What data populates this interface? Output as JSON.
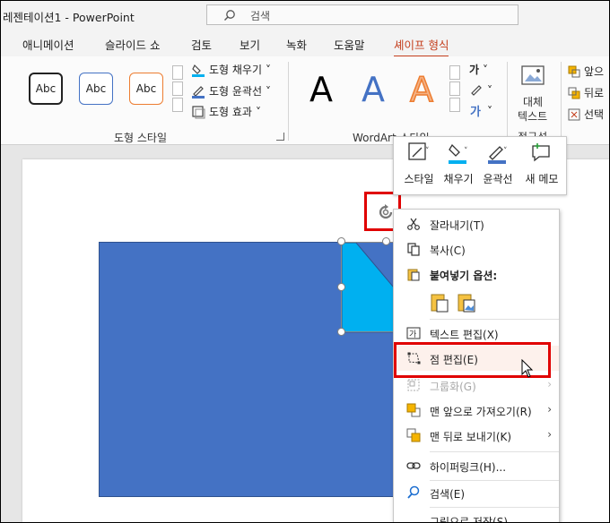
{
  "titlebar": {
    "title": "레젠테이션1  -  PowerPoint",
    "search_placeholder": "검색"
  },
  "tabs": [
    "애니메이션",
    "슬라이드 쇼",
    "검토",
    "보기",
    "녹화",
    "도움말",
    "셰이프 형식"
  ],
  "ribbon": {
    "shape_styles": {
      "swatch_labels": [
        "Abc",
        "Abc",
        "Abc"
      ],
      "fill": "도형 채우기",
      "outline": "도형 윤곽선",
      "effects": "도형 효과",
      "group_label": "도형 스타일"
    },
    "wordart": {
      "letters": [
        "A",
        "A",
        "A"
      ],
      "group_label": "WordArt 스타일",
      "text_fill_glyph": "가"
    },
    "alt_text": {
      "line1": "대체",
      "line2": "텍스트",
      "group_label": "접근성"
    },
    "arrange": {
      "forward": "앞으",
      "backward": "뒤로",
      "select": "선택"
    }
  },
  "mini_toolbar": {
    "style": "스타일",
    "fill": "채우기",
    "outline": "윤곽선",
    "new_memo": "새 메모"
  },
  "context_menu": {
    "cut": "잘라내기(T)",
    "copy": "복사(C)",
    "paste_options": "붙여넣기 옵션:",
    "edit_text": "텍스트 편집(X)",
    "edit_points": "점 편집(E)",
    "group": "그룹화(G)",
    "bring_front": "맨 앞으로 가져오기(R)",
    "send_back": "맨 뒤로 보내기(K)",
    "hyperlink": "하이퍼링크(H)...",
    "search": "검색(E)",
    "save_as_picture": "그림으로 저장(S)..."
  },
  "colors": {
    "accent": "#c43e1c",
    "shape_blue": "#4472c4",
    "shape_cyan": "#00b0f0",
    "highlight_red": "#e00000"
  }
}
